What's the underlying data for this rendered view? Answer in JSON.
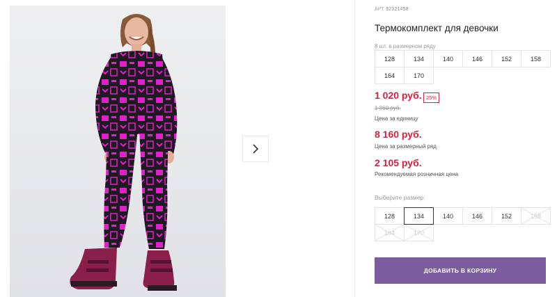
{
  "product": {
    "art_label": "АРТ",
    "art_number": "32321458",
    "title": "Термокомплект для девочки"
  },
  "pack": {
    "label": "8 шт. в размерном ряду",
    "sizes": [
      "128",
      "134",
      "140",
      "146",
      "152",
      "158",
      "164",
      "170"
    ]
  },
  "prices": {
    "unit_price": "1 020 руб.",
    "discount": "25%",
    "old_price": "1 360 руб.",
    "unit_label": "Цена за единицу",
    "pack_price": "8 160 руб.",
    "pack_label": "Цена за размерный ряд",
    "rrp": "2 105 руб.",
    "rrp_label": "Рекомендуемая розничная цена"
  },
  "size_select": {
    "label": "Выберите размер:",
    "sizes": [
      {
        "value": "128",
        "state": "available"
      },
      {
        "value": "134",
        "state": "selected"
      },
      {
        "value": "140",
        "state": "available"
      },
      {
        "value": "146",
        "state": "available"
      },
      {
        "value": "152",
        "state": "available"
      },
      {
        "value": "158",
        "state": "disabled"
      },
      {
        "value": "164",
        "state": "disabled"
      },
      {
        "value": "170",
        "state": "disabled"
      }
    ]
  },
  "cart_button": {
    "label": "ДОБАВИТЬ В КОРЗИНУ",
    "color": "#7b5c9e"
  },
  "colors": {
    "price_red": "#d81f3c",
    "accent_purple": "#7b5c9e",
    "print_pink": "#e020c8"
  },
  "icons": {
    "next_arrow": "chevron-right-icon"
  }
}
